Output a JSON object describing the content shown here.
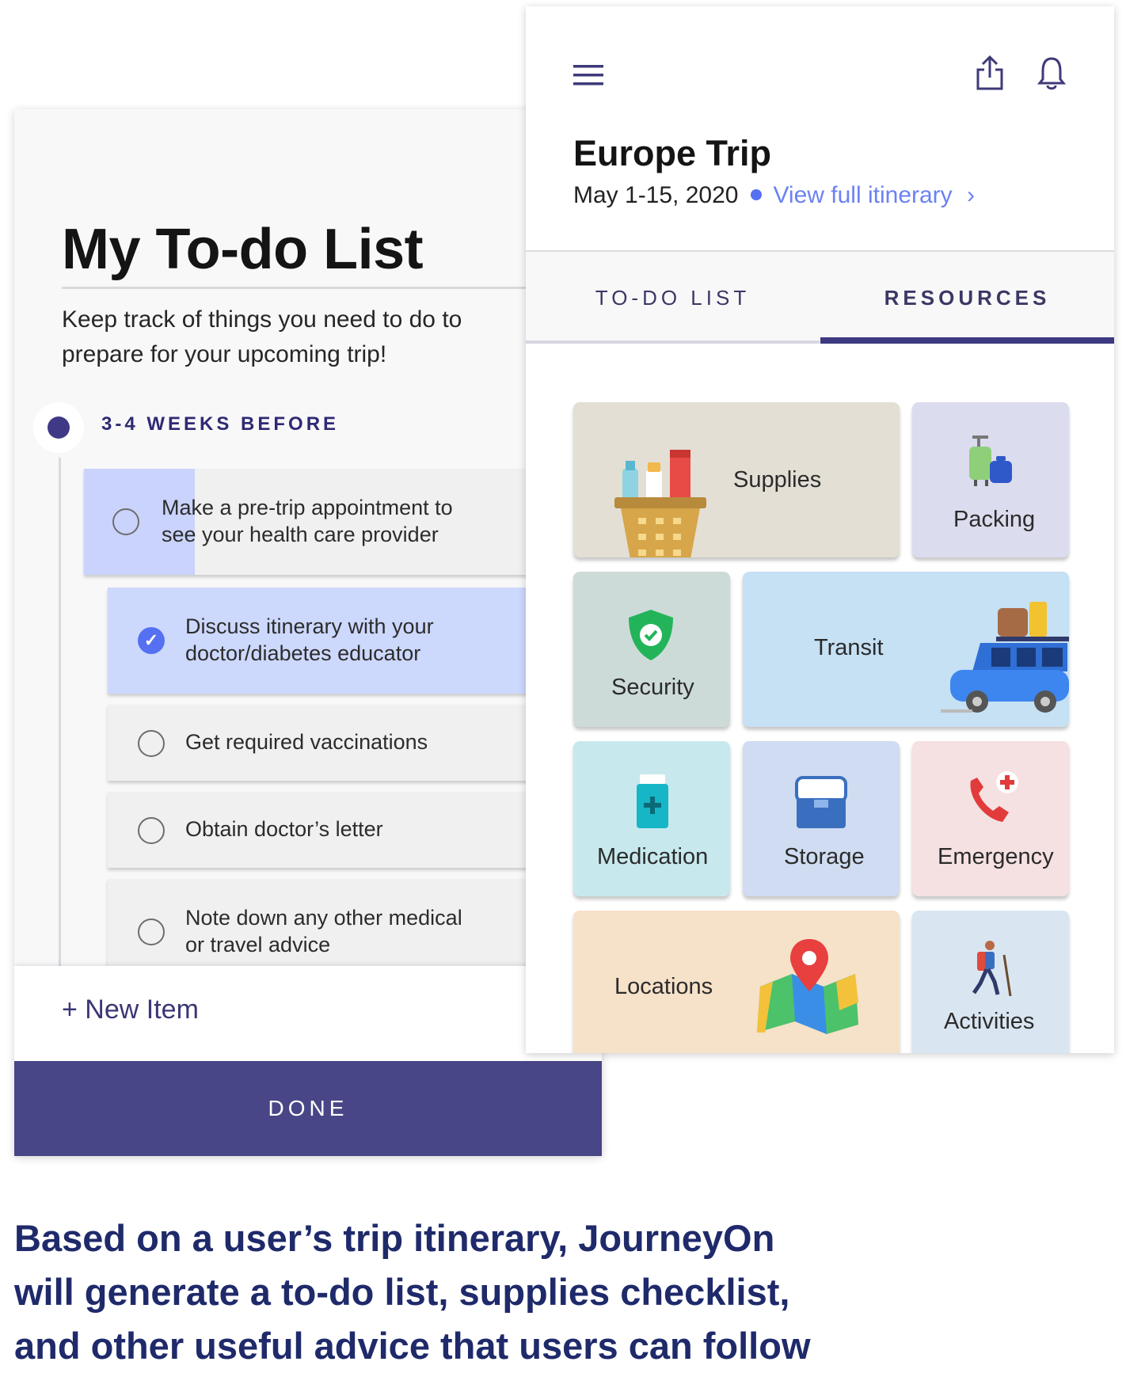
{
  "todo": {
    "title": "My To-do List",
    "subtitle": "Keep track of things you need to do to prepare for your upcoming trip!",
    "section_label": "3-4 WEEKS BEFORE",
    "tasks": [
      {
        "line1": "Make a pre-trip appointment to",
        "line2": "see your health care provider",
        "checked": false
      },
      {
        "line1": "Discuss itinerary with your",
        "line2": "doctor/diabetes educator",
        "checked": true
      },
      {
        "line1": "Get required vaccinations",
        "line2": "",
        "checked": false
      },
      {
        "line1": "Obtain doctor’s letter",
        "line2": "",
        "checked": false
      },
      {
        "line1": "Note down any other medical",
        "line2": "or travel advice",
        "checked": false
      }
    ],
    "new_item_label": "+ New Item",
    "done_label": "DONE"
  },
  "trip": {
    "title": "Europe Trip",
    "dates": "May 1-15, 2020",
    "itinerary_link": "View full itinerary",
    "itinerary_chevron": "›"
  },
  "tabs": [
    {
      "label": "TO-DO LIST",
      "active": false
    },
    {
      "label": "RESOURCES",
      "active": true
    }
  ],
  "resources": [
    {
      "label": "Supplies",
      "icon": "basket-icon",
      "color": "#e3dfd5"
    },
    {
      "label": "Packing",
      "icon": "luggage-icon",
      "color": "#dcdcef"
    },
    {
      "label": "Security",
      "icon": "shield-icon",
      "color": "#cddbd8"
    },
    {
      "label": "Transit",
      "icon": "car-icon",
      "color": "#c6e0f4"
    },
    {
      "label": "Medication",
      "icon": "medicine-bottle-icon",
      "color": "#c7e9ed"
    },
    {
      "label": "Storage",
      "icon": "cooler-icon",
      "color": "#cfdcf1"
    },
    {
      "label": "Emergency",
      "icon": "phone-icon",
      "color": "#f5e0e2"
    },
    {
      "label": "Locations",
      "icon": "map-pin-icon",
      "color": "#f6e1c9"
    },
    {
      "label": "Activities",
      "icon": "hiker-icon",
      "color": "#d9e6f1"
    }
  ],
  "caption": "Based on a user’s trip itinerary, JourneyOn will generate a to-do list, supplies checklist, and other useful advice that users can follow",
  "colors": {
    "primary": "#484687",
    "accent_blue": "#5570f1",
    "link": "#6a82f2",
    "caption": "#1f2a6b"
  }
}
